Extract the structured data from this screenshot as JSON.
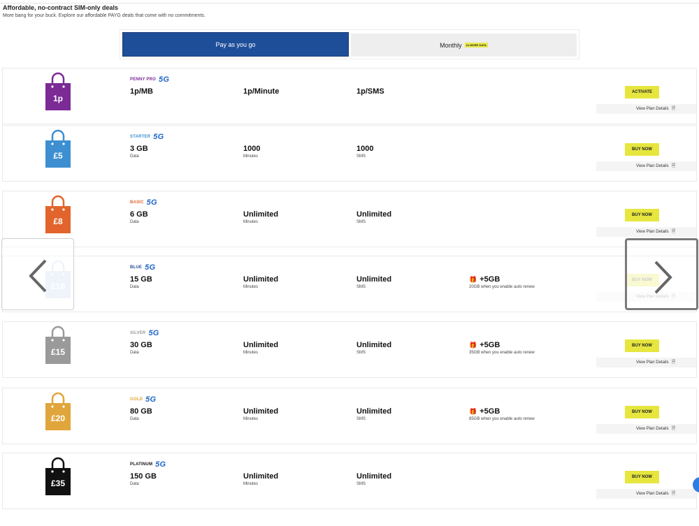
{
  "header": {
    "title": "Affordable, no-contract SIM-only deals",
    "subtitle": "More bang for your buck. Explore our affordable PAYG deals that come with no commitments."
  },
  "toggle": {
    "payg_label": "Pay as you go",
    "monthly_label": "Monthly",
    "monthly_badge": "2x MORE DATA"
  },
  "badge_5g": "5G",
  "details_label": "View Plan Details",
  "plans": [
    {
      "name": "PENNY PRO",
      "price": "1p",
      "color": "#7b2a96",
      "name_color": "#7b2a96",
      "c1": "1p/MB",
      "c1_label": "",
      "c2": "1p/Minute",
      "c2_label": "",
      "c3": "1p/SMS",
      "c3_label": "",
      "bonus": "",
      "bonus_label": "",
      "button": "ACTIVATE"
    },
    {
      "name": "STARTER",
      "price": "£5",
      "color": "#3d8fd1",
      "name_color": "#3d8fd1",
      "c1": "3 GB",
      "c1_label": "Data",
      "c2": "1000",
      "c2_label": "Minutes",
      "c3": "1000",
      "c3_label": "SMS",
      "bonus": "",
      "bonus_label": "",
      "button": "BUY NOW"
    },
    {
      "name": "BASIC",
      "price": "£8",
      "color": "#e2642c",
      "name_color": "#e2642c",
      "c1": "6 GB",
      "c1_label": "Data",
      "c2": "Unlimited",
      "c2_label": "Minutes",
      "c3": "Unlimited",
      "c3_label": "SMS",
      "bonus": "",
      "bonus_label": "",
      "button": "BUY NOW"
    },
    {
      "name": "BLUE",
      "price": "£10",
      "color": "#9cbde0",
      "name_color": "#1f4e99",
      "c1": "15 GB",
      "c1_label": "Data",
      "c2": "Unlimited",
      "c2_label": "Minutes",
      "c3": "Unlimited",
      "c3_label": "SMS",
      "bonus": "+5GB",
      "bonus_label": "20GB when you enable auto renew",
      "button": "BUY NOW"
    },
    {
      "name": "SILVER",
      "price": "£15",
      "color": "#9a9a9a",
      "name_color": "#9a9a9a",
      "c1": "30 GB",
      "c1_label": "Data",
      "c2": "Unlimited",
      "c2_label": "Minutes",
      "c3": "Unlimited",
      "c3_label": "SMS",
      "bonus": "+5GB",
      "bonus_label": "35GB when you enable auto renew",
      "button": "BUY NOW"
    },
    {
      "name": "GOLD",
      "price": "£20",
      "color": "#e0a53b",
      "name_color": "#e0a53b",
      "c1": "80 GB",
      "c1_label": "Data",
      "c2": "Unlimited",
      "c2_label": "Minutes",
      "c3": "Unlimited",
      "c3_label": "SMS",
      "bonus": "+5GB",
      "bonus_label": "85GB when you enable auto renew",
      "button": "BUY NOW"
    },
    {
      "name": "PLATINUM",
      "price": "£35",
      "color": "#111111",
      "name_color": "#111111",
      "c1": "150 GB",
      "c1_label": "Data",
      "c2": "Unlimited",
      "c2_label": "Minutes",
      "c3": "Unlimited",
      "c3_label": "SMS",
      "bonus": "",
      "bonus_label": "",
      "button": "BUY NOW"
    }
  ],
  "nav": {
    "prev_icon": "chevron-left-icon",
    "next_icon": "chevron-right-icon"
  }
}
